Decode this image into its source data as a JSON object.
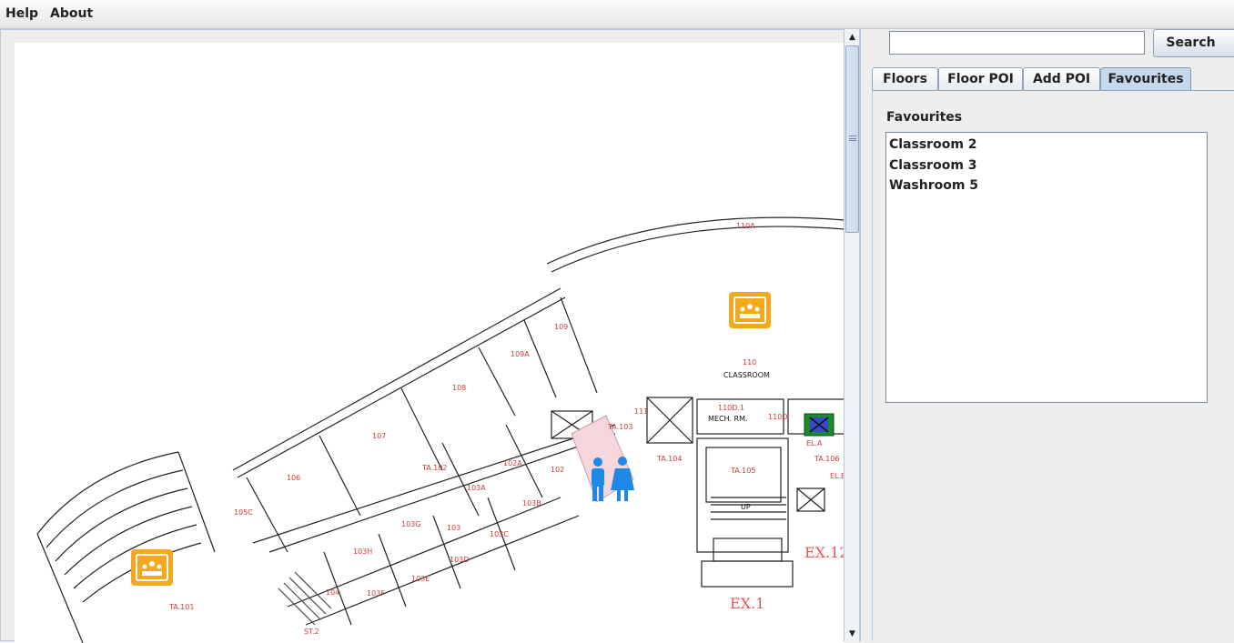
{
  "menu": {
    "help": "Help",
    "about": "About"
  },
  "search": {
    "value": "",
    "placeholder": "",
    "button_label": "Search"
  },
  "tabs": [
    {
      "label": "Floors"
    },
    {
      "label": "Floor POI"
    },
    {
      "label": "Add POI"
    },
    {
      "label": "Favourites",
      "selected": true
    }
  ],
  "favourites": {
    "title": "Favourites",
    "items": [
      "Classroom 2",
      "Classroom 3",
      "Washroom 5"
    ]
  },
  "map": {
    "rooms": [
      "110A",
      "110",
      "CLASSROOM",
      "109",
      "109A",
      "108",
      "107",
      "106",
      "105C",
      "111",
      "110D.1",
      "MECH. RM.",
      "110D",
      "TA.104",
      "TA.105",
      "TA.106",
      "TA.102",
      "TA.103",
      "102A",
      "102",
      "103A",
      "103B",
      "103G",
      "103",
      "103C",
      "103H",
      "103D",
      "103E",
      "103F",
      "104",
      "TA.101",
      "ST.2",
      "EL.A",
      "EL.B",
      "UP",
      "EX.1",
      "EX.12"
    ],
    "poi_icons": [
      "classroom-icon",
      "classroom-icon",
      "washroom-icon",
      "elevator-icon"
    ],
    "colors": {
      "poi": "#f5a81c",
      "washroom": "#1e88e5",
      "room_label": "#d23a3a",
      "exit_label": "#e05a5a",
      "highlight": "#f6d6dc"
    }
  }
}
